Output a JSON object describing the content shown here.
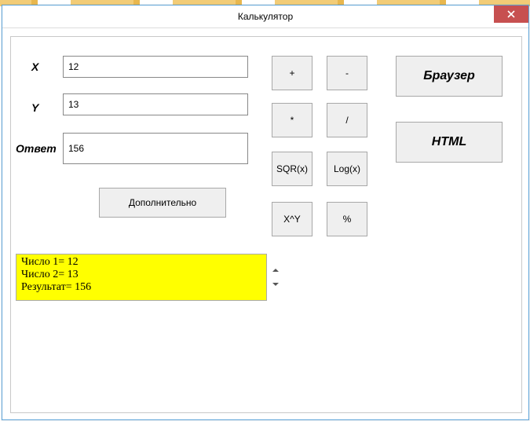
{
  "window": {
    "title": "Калькулятор",
    "close_label": "×"
  },
  "labels": {
    "x": "X",
    "y": "Y",
    "answer": "Ответ"
  },
  "inputs": {
    "x": "12",
    "y": "13",
    "answer": "156"
  },
  "ops": {
    "plus": "+",
    "minus": "-",
    "mul": "*",
    "div": "/",
    "sqr": "SQR(x)",
    "log": "Log(x)",
    "pow": "X^Y",
    "pct": "%"
  },
  "buttons": {
    "more": "Дополнительно",
    "browser": "Браузер",
    "html": "HTML"
  },
  "log": {
    "line1": "Число 1= 12",
    "line2": "Число 2= 13",
    "line3": "Результат= 156"
  }
}
